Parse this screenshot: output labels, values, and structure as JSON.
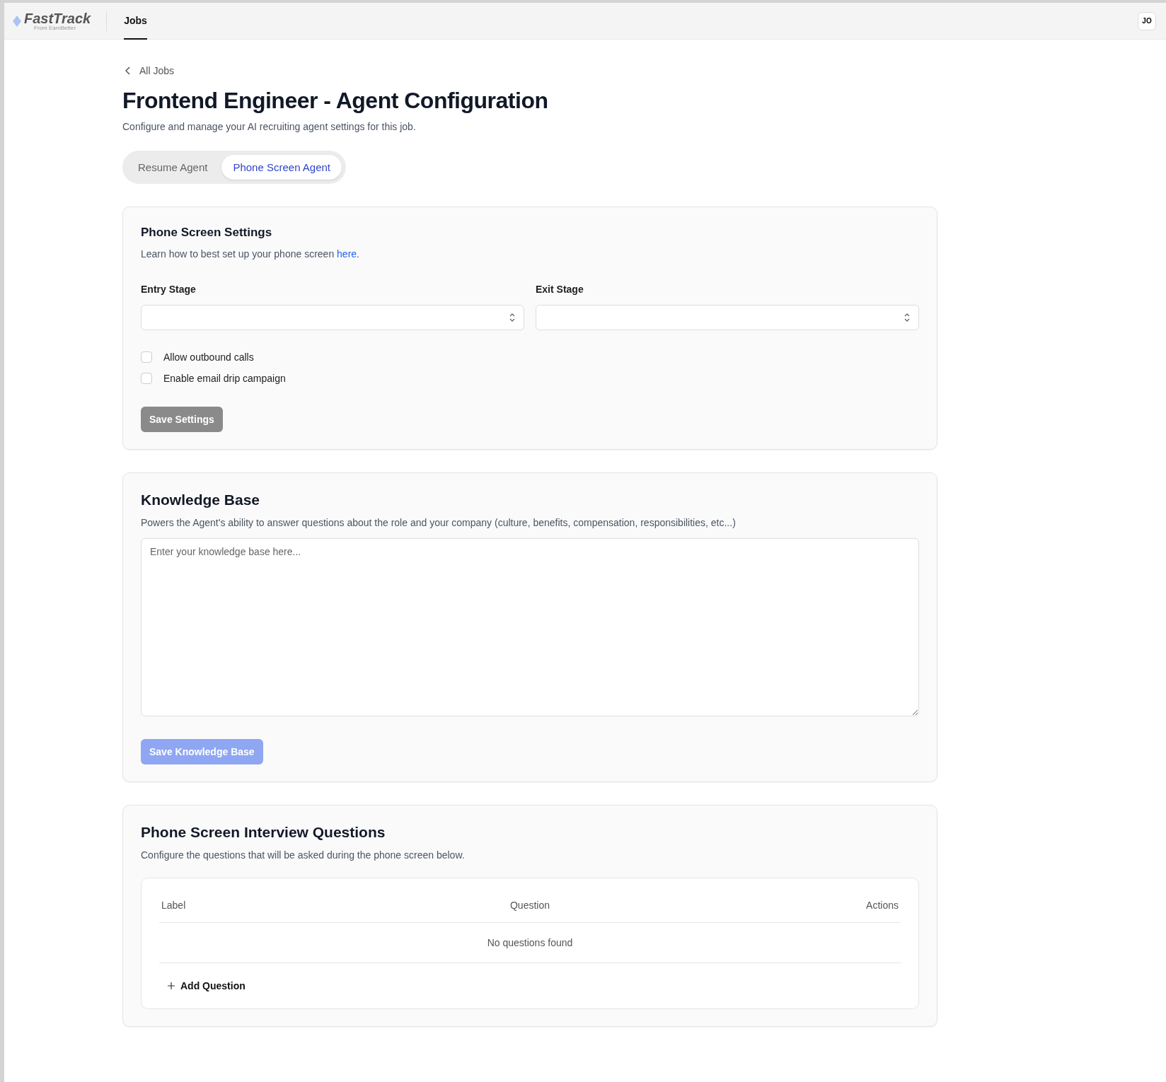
{
  "header": {
    "logo": "FastTrack",
    "logo_subtitle": "From EarnBetter",
    "nav": [
      {
        "label": "Jobs",
        "selected": true
      }
    ],
    "avatar": "JO"
  },
  "breadcrumb": "All Jobs",
  "title": "Frontend Engineer - Agent Configuration",
  "subtitle": "Configure and manage your AI recruiting agent settings for this job.",
  "tabs": [
    {
      "label": "Resume Agent",
      "selected": false
    },
    {
      "label": "Phone Screen Agent",
      "selected": true
    }
  ],
  "settings": {
    "title": "Phone Screen Settings",
    "description": "Learn how to best set up your phone screen ",
    "link": "here",
    "description_end": ".",
    "selects": [
      {
        "label": "Entry Stage"
      },
      {
        "label": "Exit Stage"
      }
    ],
    "checkboxes": [
      {
        "label": "Allow outbound calls",
        "checked": false
      },
      {
        "label": "Enable email drip campaign",
        "checked": false
      }
    ],
    "button": {
      "label": "Save Settings",
      "disabled": true
    }
  },
  "knowledge_base": {
    "title": "Knowledge Base",
    "description": "Powers the Agent's ability to answer questions about the role and your company (culture, benefits, compensation, responsibilities, etc...)",
    "placeholder": "Enter your knowledge base here...",
    "button": {
      "label": "Save Knowledge Base",
      "disabled": true
    }
  },
  "questions": {
    "title": "Phone Screen Interview Questions",
    "description": "Configure the questions that will be asked during the phone screen below.",
    "columns": [
      "Label",
      "Question",
      "Actions"
    ],
    "empty": "No questions found",
    "add": "Add Question"
  }
}
